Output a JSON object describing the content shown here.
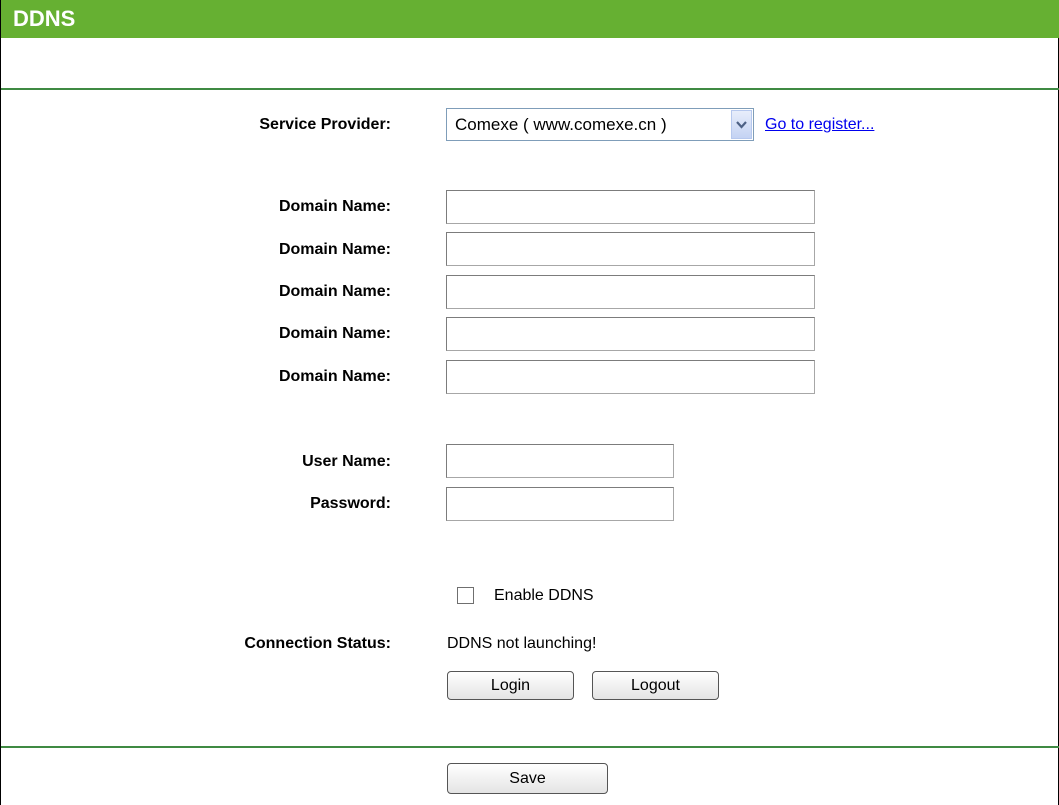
{
  "header": {
    "title": "DDNS"
  },
  "form": {
    "service_provider_label": "Service Provider:",
    "service_provider_value": "Comexe ( www.comexe.cn )",
    "register_link": "Go to register...",
    "domain_name_label": "Domain Name:",
    "domain_names": [
      "",
      "",
      "",
      "",
      ""
    ],
    "user_name_label": "User Name:",
    "user_name_value": "",
    "password_label": "Password:",
    "password_value": "",
    "enable_ddns_label": "Enable DDNS",
    "enable_ddns_checked": false,
    "connection_status_label": "Connection Status:",
    "connection_status_value": "DDNS not launching!"
  },
  "buttons": {
    "login": "Login",
    "logout": "Logout",
    "save": "Save"
  }
}
